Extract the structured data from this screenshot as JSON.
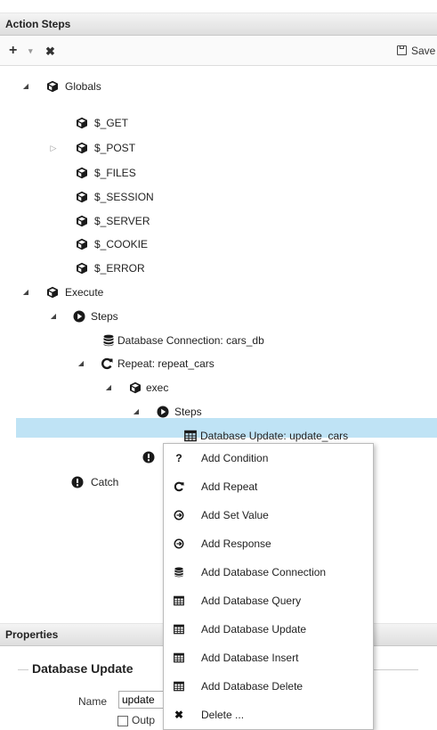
{
  "header": {
    "title": "Action Steps"
  },
  "toolbar": {
    "add": "+",
    "dropdown": "▾",
    "delete": "✖",
    "save_label": "Save"
  },
  "tree": {
    "globals": "Globals",
    "get": "$_GET",
    "post": "$_POST",
    "files": "$_FILES",
    "session": "$_SESSION",
    "server": "$_SERVER",
    "cookie": "$_COOKIE",
    "error": "$_ERROR",
    "execute": "Execute",
    "steps": "Steps",
    "db_connection": "Database Connection: cars_db",
    "repeat": "Repeat: repeat_cars",
    "exec": "exec",
    "inner_steps": "Steps",
    "db_update": "Database Update: update_cars",
    "catch": "Catch"
  },
  "context_menu": {
    "items": [
      {
        "label": "Add Condition",
        "icon": "question-icon"
      },
      {
        "label": "Add Repeat",
        "icon": "repeat-icon"
      },
      {
        "label": "Add Set Value",
        "icon": "circle-arrow-icon"
      },
      {
        "label": "Add Response",
        "icon": "circle-arrow-icon"
      },
      {
        "label": "Add Database Connection",
        "icon": "database-icon"
      },
      {
        "label": "Add Database Query",
        "icon": "table-icon"
      },
      {
        "label": "Add Database Update",
        "icon": "table-icon"
      },
      {
        "label": "Add Database Insert",
        "icon": "table-icon"
      },
      {
        "label": "Add Database Delete",
        "icon": "table-icon"
      },
      {
        "label": "Delete ...",
        "icon": "delete-icon"
      }
    ]
  },
  "properties": {
    "title": "Properties",
    "section": "Database Update",
    "name_label": "Name",
    "name_value": "update",
    "output_label": "Outp"
  },
  "colors": {
    "selection": "#bfe3f5",
    "header_bg": "#e4e4e4"
  }
}
